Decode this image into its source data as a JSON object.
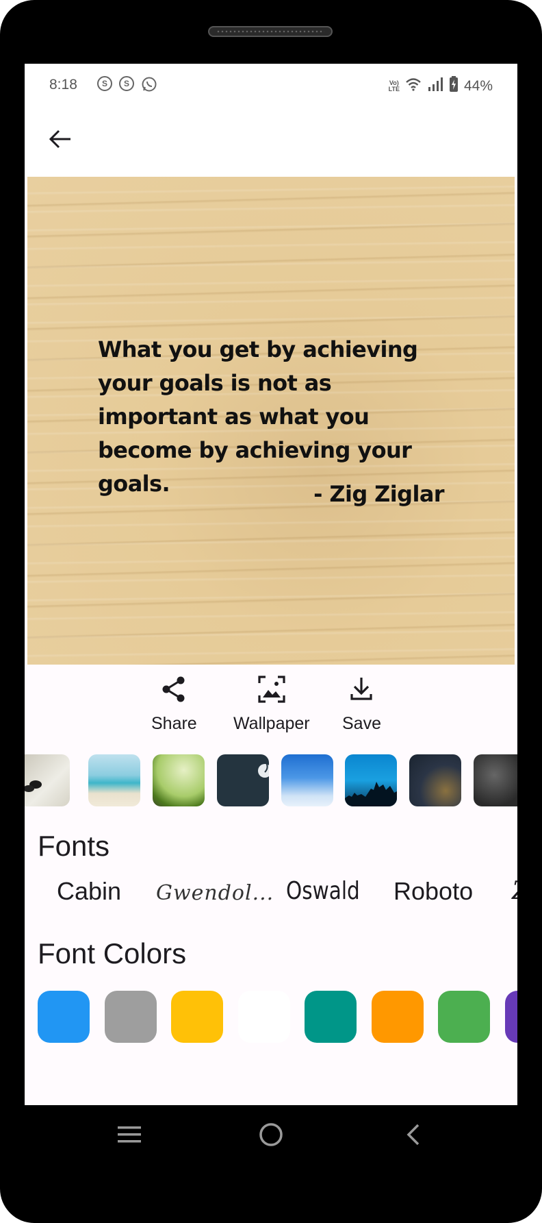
{
  "status_bar": {
    "time": "8:18",
    "notification_icons": [
      "s-icon",
      "s-icon",
      "whatsapp-icon"
    ],
    "network_label_top": "Vo)",
    "network_label_bottom": "LTE",
    "battery": "44%"
  },
  "app_bar": {
    "back_icon": "arrow-left-icon"
  },
  "quote_card": {
    "quote": "What you get by achieving your goals is not as important as what you become by achieving your goals.",
    "author": "- Zig Ziglar",
    "background": "light-wood-texture"
  },
  "actions": [
    {
      "label": "Share",
      "icon": "share-icon"
    },
    {
      "label": "Wallpaper",
      "icon": "wallpaper-icon"
    },
    {
      "label": "Save",
      "icon": "download-icon"
    }
  ],
  "backgrounds": [
    {
      "name": "hearts-stones",
      "colors": [
        "#d8d4c8",
        "#ecebe4"
      ]
    },
    {
      "name": "beach-sea",
      "colors": [
        "#64c4d8",
        "#c9e8ef"
      ]
    },
    {
      "name": "grass-bokeh",
      "colors": [
        "#c8df9a",
        "#6a9a2c"
      ]
    },
    {
      "name": "dark-teal-music",
      "colors": [
        "#233440",
        "#2b3d4a"
      ]
    },
    {
      "name": "blue-sky-clouds",
      "colors": [
        "#2d7ad8",
        "#9fcaf1"
      ]
    },
    {
      "name": "blue-city-skyline",
      "colors": [
        "#0a80c8",
        "#07304e"
      ]
    },
    {
      "name": "city-night-lights",
      "colors": [
        "#1d2a38",
        "#5a5040"
      ]
    },
    {
      "name": "dark-texture",
      "colors": [
        "#2a2a2a",
        "#555555"
      ]
    }
  ],
  "fonts": {
    "title": "Fonts",
    "items": [
      "Cabin",
      "Gwendol...",
      "Oswald",
      "Roboto",
      "Z"
    ]
  },
  "font_colors": {
    "title": "Font Colors",
    "swatches": [
      "#2196f3",
      "#9e9e9e",
      "#ffc107",
      "#ffffff",
      "#009688",
      "#ff9800",
      "#4caf50",
      "#673ab7"
    ]
  },
  "nav_bar": {
    "icons": [
      "menu-icon",
      "home-circle-icon",
      "back-chevron-icon"
    ]
  }
}
